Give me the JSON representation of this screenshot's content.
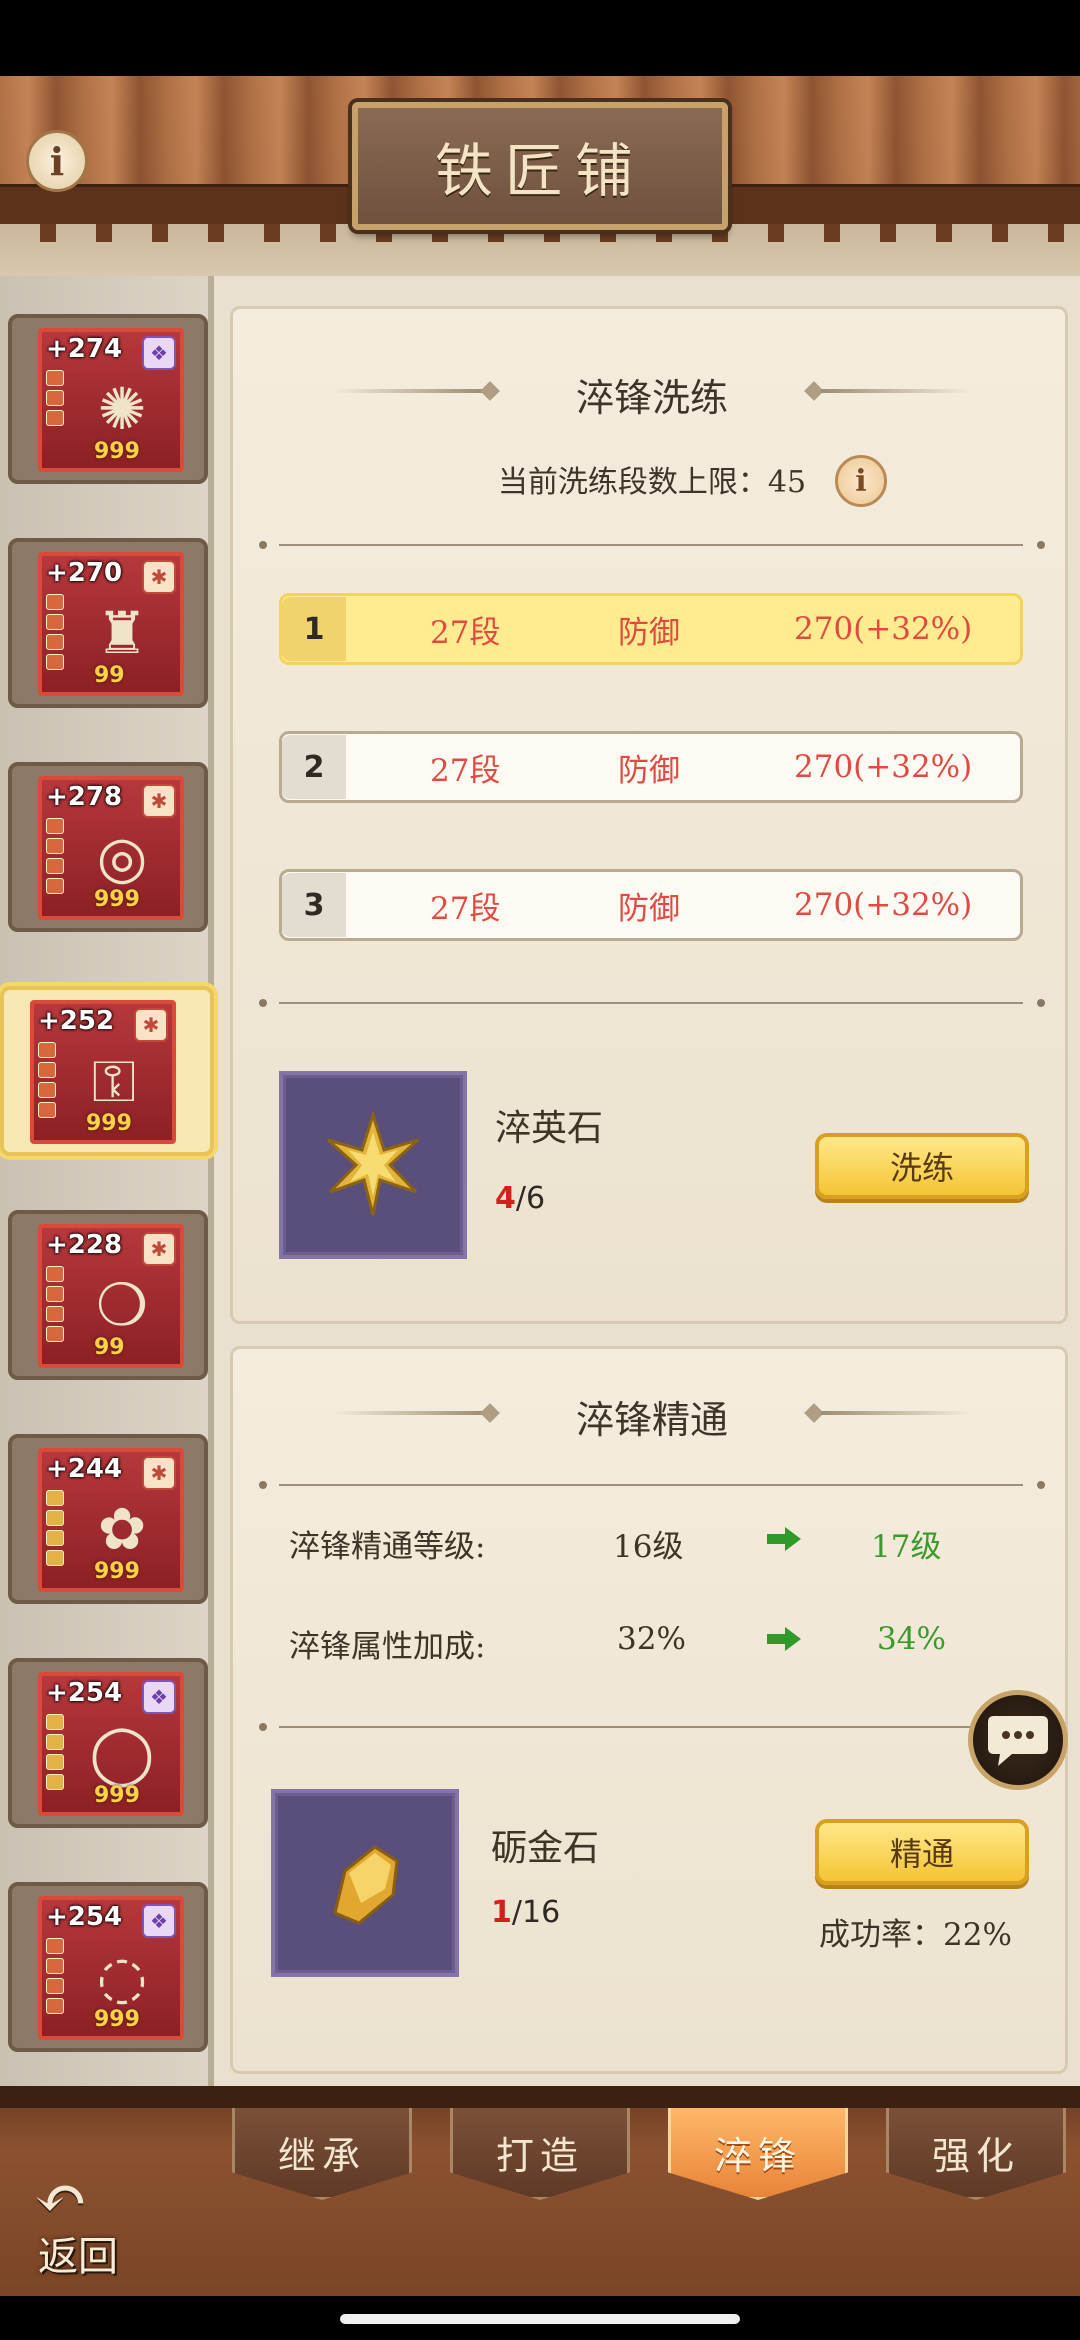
{
  "header": {
    "title": "铁匠铺"
  },
  "sidebar": {
    "items": [
      {
        "bonus": "+274",
        "count": "999",
        "badge": "purple",
        "icon": "fan-icon",
        "glyph": "✺"
      },
      {
        "bonus": "+270",
        "count": "99",
        "badge": "red",
        "icon": "robe-icon",
        "glyph": "♜"
      },
      {
        "bonus": "+278",
        "count": "999",
        "badge": "red",
        "icon": "belt-icon",
        "glyph": "◎"
      },
      {
        "bonus": "+252",
        "count": "999",
        "badge": "red",
        "icon": "boots-icon",
        "glyph": "⚿",
        "selected": true
      },
      {
        "bonus": "+228",
        "count": "99",
        "badge": "red",
        "icon": "necklace-icon",
        "glyph": "❍"
      },
      {
        "bonus": "+244",
        "count": "999",
        "badge": "red",
        "icon": "hairpin-icon",
        "glyph": "✿"
      },
      {
        "bonus": "+254",
        "count": "999",
        "badge": "purple",
        "icon": "bracelet-icon",
        "glyph": "◯"
      },
      {
        "bonus": "+254",
        "count": "999",
        "badge": "purple",
        "icon": "ring-icon",
        "glyph": "◌"
      }
    ]
  },
  "refine": {
    "title": "淬锋洗练",
    "limit_label": "当前洗练段数上限：45",
    "rows": [
      {
        "index": "1",
        "tier": "27段",
        "attr": "防御",
        "value": "270(+32%)"
      },
      {
        "index": "2",
        "tier": "27段",
        "attr": "防御",
        "value": "270(+32%)"
      },
      {
        "index": "3",
        "tier": "27段",
        "attr": "防御",
        "value": "270(+32%)"
      }
    ],
    "stone_name": "淬英石",
    "stone_have": "4",
    "stone_need": "/6",
    "button": "洗练"
  },
  "mastery": {
    "title": "淬锋精通",
    "level_label": "淬锋精通等级:",
    "level_current": "16级",
    "level_next": "17级",
    "bonus_label": "淬锋属性加成:",
    "bonus_current": "32%",
    "bonus_next": "34%",
    "stone_name": "砺金石",
    "stone_have": "1",
    "stone_need": "/16",
    "button": "精通",
    "success_rate": "成功率：22%"
  },
  "tabs": [
    "继承",
    "打造",
    "淬锋",
    "强化"
  ],
  "active_tab": "淬锋",
  "back_label": "返回",
  "colors": {
    "accent_gold": "#f4c534",
    "red_text": "#e04a40",
    "green_text": "#3c9a2c"
  }
}
